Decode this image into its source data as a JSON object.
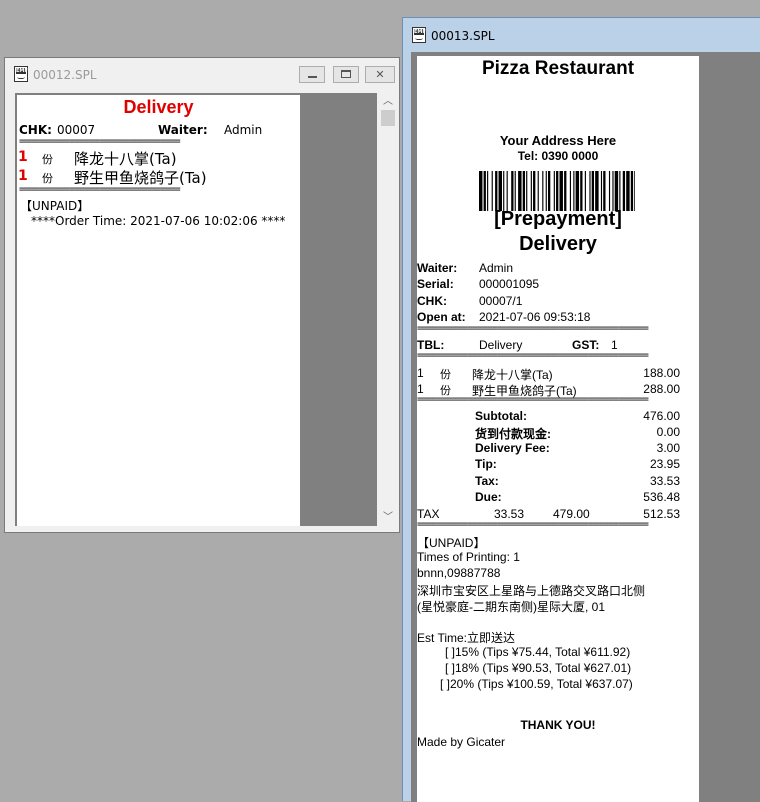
{
  "colors": {
    "accent_red": "#e00000",
    "inactive_title": "#9a9a9a",
    "active_frame": "#bbd1e8"
  },
  "window_back": {
    "title": "00012.SPL",
    "icon": "emf-icon",
    "receipt": {
      "heading": "Delivery",
      "chk_label": "CHK:",
      "chk_value": "00007",
      "waiter_label": "Waiter:",
      "waiter_value": "Admin",
      "separator": "================================",
      "items": [
        {
          "qty": "1",
          "unit": "份",
          "name": "降龙十八掌(Ta)"
        },
        {
          "qty": "1",
          "unit": "份",
          "name": "野生甲鱼烧鸽子(Ta)"
        }
      ],
      "status": "【UNPAID】",
      "order_time": "****Order Time: 2021-07-06 10:02:06 ****"
    }
  },
  "window_front": {
    "title": "00013.SPL",
    "icon": "emf-icon",
    "receipt": {
      "restaurant": "Pizza Restaurant",
      "address": "Your Address Here",
      "tel": "Tel: 0390 0000",
      "prepayment": "[Prepayment]",
      "order_type": "Delivery",
      "info": [
        {
          "label": "Waiter:",
          "value": "Admin"
        },
        {
          "label": "Serial:",
          "value": "000001095"
        },
        {
          "label": "CHK:",
          "value": "00007/1"
        },
        {
          "label": "Open at:",
          "value": "2021-07-06 09:53:18"
        }
      ],
      "separator": "==============================================",
      "tbl_label": "TBL:",
      "tbl_value": "Delivery",
      "gst_label": "GST:",
      "gst_value": "1",
      "items": [
        {
          "qty": "1",
          "unit": "份",
          "name": "降龙十八掌(Ta)",
          "price": "188.00"
        },
        {
          "qty": "1",
          "unit": "份",
          "name": "野生甲鱼烧鸽子(Ta)",
          "price": "288.00"
        }
      ],
      "totals": [
        {
          "label": "Subtotal:",
          "value": "476.00"
        },
        {
          "label": "货到付款现金:",
          "value": "0.00"
        },
        {
          "label": "Delivery Fee:",
          "value": "3.00"
        },
        {
          "label": "Tip:",
          "value": "23.95"
        },
        {
          "label": "Tax:",
          "value": "33.53"
        },
        {
          "label": "Due:",
          "value": "536.48"
        }
      ],
      "tax_row": {
        "label": "TAX",
        "tax": "33.53",
        "base": "479.00",
        "total": "512.53"
      },
      "status": "【UNPAID】",
      "times_printing": "Times of Printing: 1",
      "customer": "bnnn,09887788",
      "address_line1": "深圳市宝安区上星路与上德路交叉路口北侧",
      "address_line2": "(星悦豪庭-二期东南侧)星际大厦, 01",
      "est_time": "Est Time:立即送达",
      "tip_options": [
        "[  ]15% (Tips ¥75.44, Total ¥611.92)",
        "[  ]18% (Tips ¥90.53, Total ¥627.01)",
        "[  ]20% (Tips ¥100.59, Total ¥637.07)"
      ],
      "thanks": "THANK YOU!",
      "footer": "Made by Gicater"
    }
  }
}
